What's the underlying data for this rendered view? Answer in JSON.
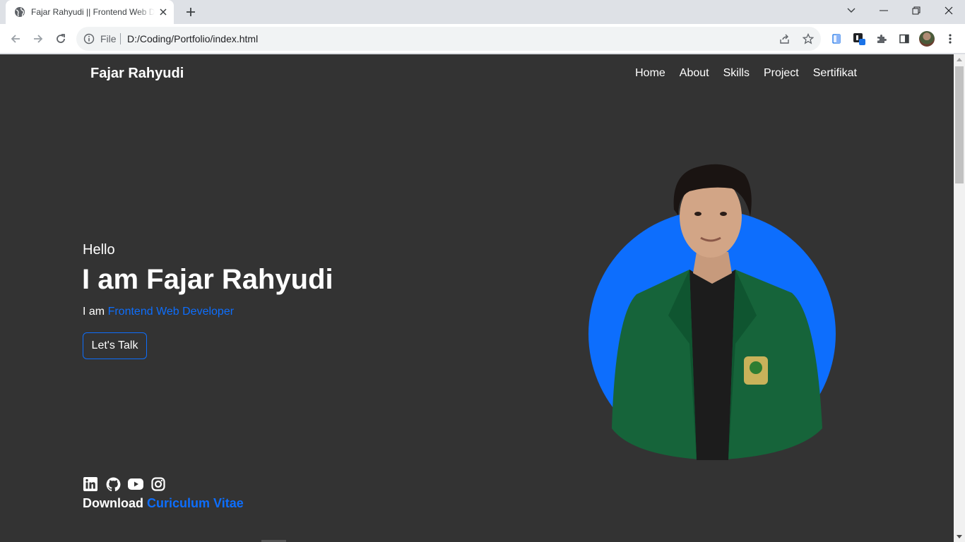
{
  "browser": {
    "tab_title": "Fajar Rahyudi || Frontend Web Developer",
    "url_scheme": "File",
    "url": "D:/Coding/Portfolio/index.html"
  },
  "site": {
    "brand": "Fajar Rahyudi",
    "nav": [
      "Home",
      "About",
      "Skills",
      "Project",
      "Sertifikat"
    ],
    "hero": {
      "greeting": "Hello",
      "headline": "I am Fajar Rahyudi",
      "role_prefix": "I am",
      "role": "Frontend Web Developer",
      "cta": "Let's Talk"
    },
    "socials": [
      "linkedin-icon",
      "github-icon",
      "youtube-icon",
      "instagram-icon"
    ],
    "download_prefix": "Download",
    "download_link": "Curiculum Vitae"
  },
  "colors": {
    "page_bg": "#333333",
    "accent": "#0d6efd",
    "jacket": "#16643a"
  }
}
